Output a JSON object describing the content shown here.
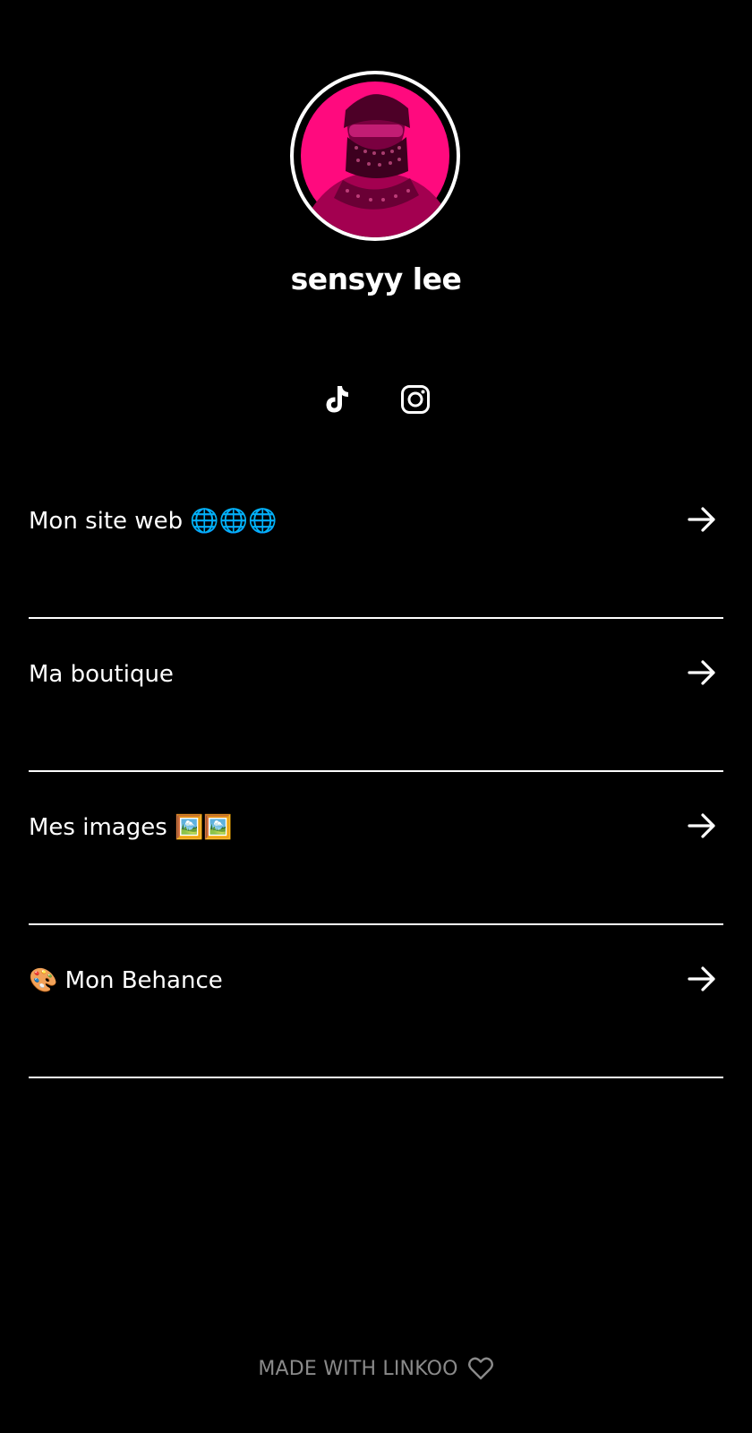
{
  "profile": {
    "name": "sensyy lee",
    "avatar_accent": "#ff0a7e"
  },
  "socials": [
    {
      "name": "TikTok",
      "icon": "tiktok-icon"
    },
    {
      "name": "Instagram",
      "icon": "instagram-icon"
    }
  ],
  "links": [
    {
      "label": "Mon site web 🌐🌐🌐",
      "icon": "arrow-right-icon"
    },
    {
      "label": "Ma boutique",
      "icon": "arrow-right-icon"
    },
    {
      "label": "Mes images 🖼️🖼️",
      "icon": "arrow-right-icon"
    },
    {
      "label": "🎨 Mon Behance",
      "icon": "arrow-right-icon"
    }
  ],
  "footer": {
    "text": "MADE WITH LINKOO",
    "icon": "heart-icon"
  },
  "colors": {
    "background": "#000000",
    "foreground": "#ffffff",
    "footer_text": "#8a8a8a"
  }
}
